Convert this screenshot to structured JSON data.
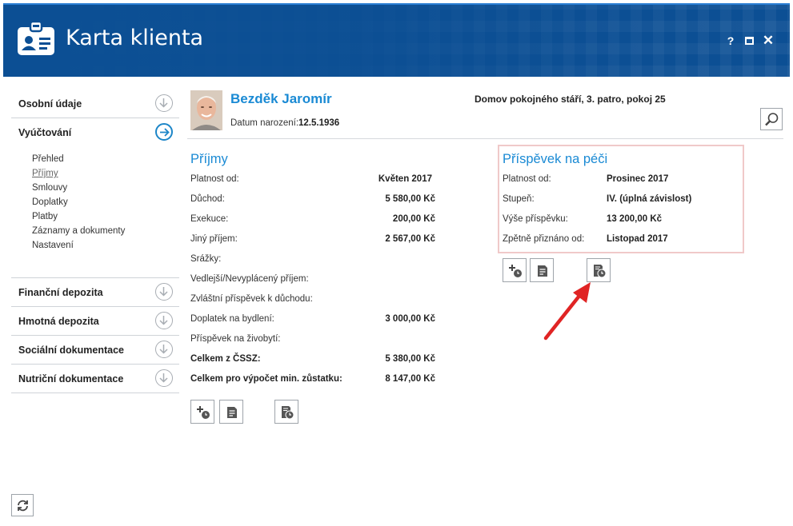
{
  "app": {
    "title": "Karta klienta",
    "help_label": "?",
    "close_label": "✕"
  },
  "colors": {
    "header_bg": "#0c4f94",
    "accent": "#1a8ad4",
    "highlight_border": "#f0c9c9",
    "annotation_arrow": "#e02424"
  },
  "sidebar": {
    "sections": [
      {
        "label": "Osobní údaje",
        "icon": "arrow-down-circle-icon"
      },
      {
        "label": "Vyúčtování",
        "icon": "arrow-right-circle-icon",
        "active": true
      },
      {
        "label": "Finanční depozita",
        "icon": "arrow-down-circle-icon"
      },
      {
        "label": "Hmotná depozita",
        "icon": "arrow-down-circle-icon"
      },
      {
        "label": "Sociální dokumentace",
        "icon": "arrow-down-circle-icon"
      },
      {
        "label": "Nutriční dokumentace",
        "icon": "arrow-down-circle-icon"
      }
    ],
    "sub_items": [
      {
        "label": "Přehled"
      },
      {
        "label": "Příjmy",
        "current": true
      },
      {
        "label": "Smlouvy"
      },
      {
        "label": "Doplatky"
      },
      {
        "label": "Platby"
      },
      {
        "label": "Záznamy a dokumenty"
      },
      {
        "label": "Nastavení"
      }
    ]
  },
  "patient": {
    "name": "Bezděk Jaromír",
    "dob_label": "Datum narození:",
    "dob_value": "12.5.1936",
    "facility": "Domov pokojného stáří, 3. patro, pokoj 25"
  },
  "income": {
    "title": "Příjmy",
    "rows": [
      {
        "label": "Platnost od:",
        "value": "Květen 2017"
      },
      {
        "label": "Důchod:",
        "value": "5 580,00 Kč"
      },
      {
        "label": "Exekuce:",
        "value": "200,00 Kč"
      },
      {
        "label": "Jiný příjem:",
        "value": "2 567,00 Kč"
      },
      {
        "label": "Srážky:",
        "value": ""
      },
      {
        "label": "Vedlejší/Nevyplácený příjem:",
        "value": ""
      },
      {
        "label": "Zvláštní příspěvek k důchodu:",
        "value": ""
      },
      {
        "label": "Doplatek na bydlení:",
        "value": "3 000,00 Kč"
      },
      {
        "label": "Příspěvek na živobytí:",
        "value": ""
      },
      {
        "label": "Celkem z ČSSZ:",
        "value": "5 380,00 Kč"
      },
      {
        "label": "Celkem pro výpočet min. zůstatku:",
        "value": "8 147,00 Kč"
      }
    ]
  },
  "care": {
    "title": "Příspěvek na péči",
    "rows": [
      {
        "label": "Platnost od:",
        "value": "Prosinec 2017"
      },
      {
        "label": "Stupeň:",
        "value": "IV. (úplná závislost)"
      },
      {
        "label": "Výše příspěvku:",
        "value": "13 200,00 Kč"
      },
      {
        "label": "Zpětně přiznáno od:",
        "value": "Listopad 2017"
      }
    ]
  },
  "buttons": {
    "add_icon": "add-clock-icon",
    "list_icon": "document-list-icon",
    "history_icon": "document-clock-icon",
    "search_icon": "magnifier-icon",
    "refresh_icon": "refresh-icon"
  }
}
